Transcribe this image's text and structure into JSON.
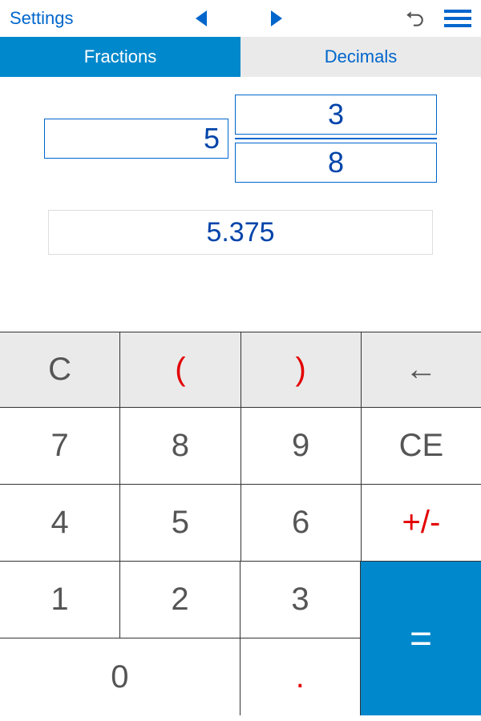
{
  "topbar": {
    "settings": "Settings"
  },
  "tabs": {
    "fractions": "Fractions",
    "decimals": "Decimals"
  },
  "input": {
    "whole": "5",
    "numerator": "3",
    "denominator": "8"
  },
  "result": "5.375",
  "keys": {
    "clear": "C",
    "lparen": "(",
    "rparen": ")",
    "backspace": "←",
    "7": "7",
    "8": "8",
    "9": "9",
    "ce": "CE",
    "4": "4",
    "5": "5",
    "6": "6",
    "plusminus": "+/-",
    "1": "1",
    "2": "2",
    "3": "3",
    "0": "0",
    "dot": ".",
    "equals": "="
  }
}
